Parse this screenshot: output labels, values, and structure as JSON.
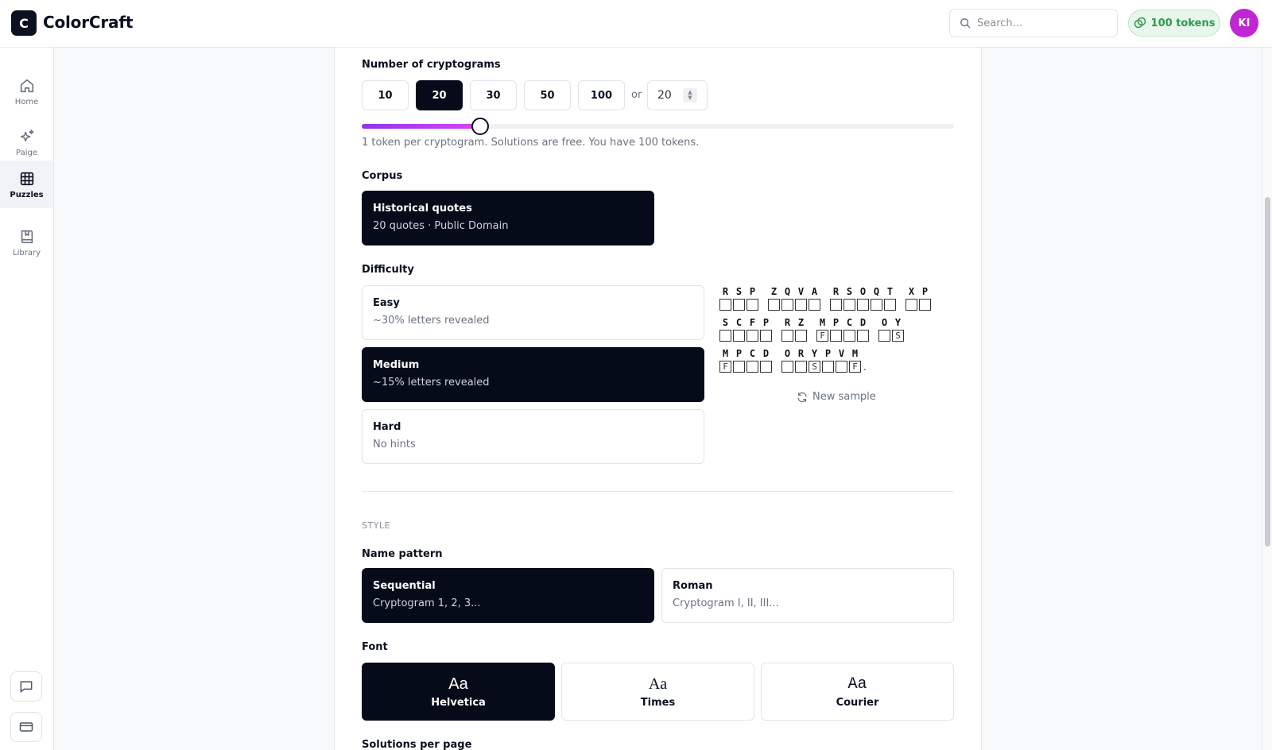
{
  "app": {
    "logo_letter": "C",
    "name": "ColorCraft"
  },
  "header": {
    "search_placeholder": "Search...",
    "tokens_label": "100 tokens",
    "avatar_initials": "KI",
    "accent": "#c026d3"
  },
  "sidebar": {
    "items": [
      {
        "label": "Home",
        "icon": "home-icon"
      },
      {
        "label": "Paige",
        "icon": "sparkles-icon"
      },
      {
        "label": "Puzzles",
        "icon": "grid-icon"
      },
      {
        "label": "Library",
        "icon": "book-icon"
      }
    ],
    "active": "Puzzles"
  },
  "count": {
    "label": "Number of cryptograms",
    "options": [
      "10",
      "20",
      "30",
      "50",
      "100"
    ],
    "selected": "20",
    "or_label": "or",
    "custom_value": "20",
    "slider_fraction": 0.2,
    "hint": "1 token per cryptogram. Solutions are free. You have 100 tokens."
  },
  "corpus": {
    "label": "Corpus",
    "title": "Historical quotes",
    "subtitle": "20 quotes · Public Domain"
  },
  "difficulty": {
    "label": "Difficulty",
    "options": [
      {
        "title": "Easy",
        "subtitle": "~30% letters revealed"
      },
      {
        "title": "Medium",
        "subtitle": "~15% letters revealed"
      },
      {
        "title": "Hard",
        "subtitle": "No hints"
      }
    ],
    "selected": "Medium"
  },
  "preview": {
    "rows": [
      [
        {
          "letters": "RSP",
          "reveals": ""
        },
        {
          "letters": "ZQVA",
          "reveals": ""
        },
        {
          "letters": "RSOQT",
          "reveals": ""
        },
        {
          "letters": "XP",
          "reveals": ""
        }
      ],
      [
        {
          "letters": "SCFP",
          "reveals": ""
        },
        {
          "letters": "RZ",
          "reveals": ""
        },
        {
          "letters": "MPCD",
          "reveals": "F   "
        },
        {
          "letters": "OY",
          "reveals": " S"
        }
      ],
      [
        {
          "letters": "MPCD",
          "reveals": "F   "
        },
        {
          "letters": "ORYPVM",
          "reveals": "  S  F",
          "punct": "."
        }
      ]
    ],
    "new_sample_label": "New sample"
  },
  "style": {
    "section_label": "STYLE",
    "name_pattern": {
      "label": "Name pattern",
      "options": [
        {
          "title": "Sequential",
          "subtitle": "Cryptogram 1, 2, 3..."
        },
        {
          "title": "Roman",
          "subtitle": "Cryptogram I, II, III..."
        }
      ],
      "selected": "Sequential"
    },
    "font": {
      "label": "Font",
      "sample": "Aa",
      "options": [
        "Helvetica",
        "Times",
        "Courier"
      ],
      "selected": "Helvetica"
    },
    "solutions_label": "Solutions per page"
  }
}
